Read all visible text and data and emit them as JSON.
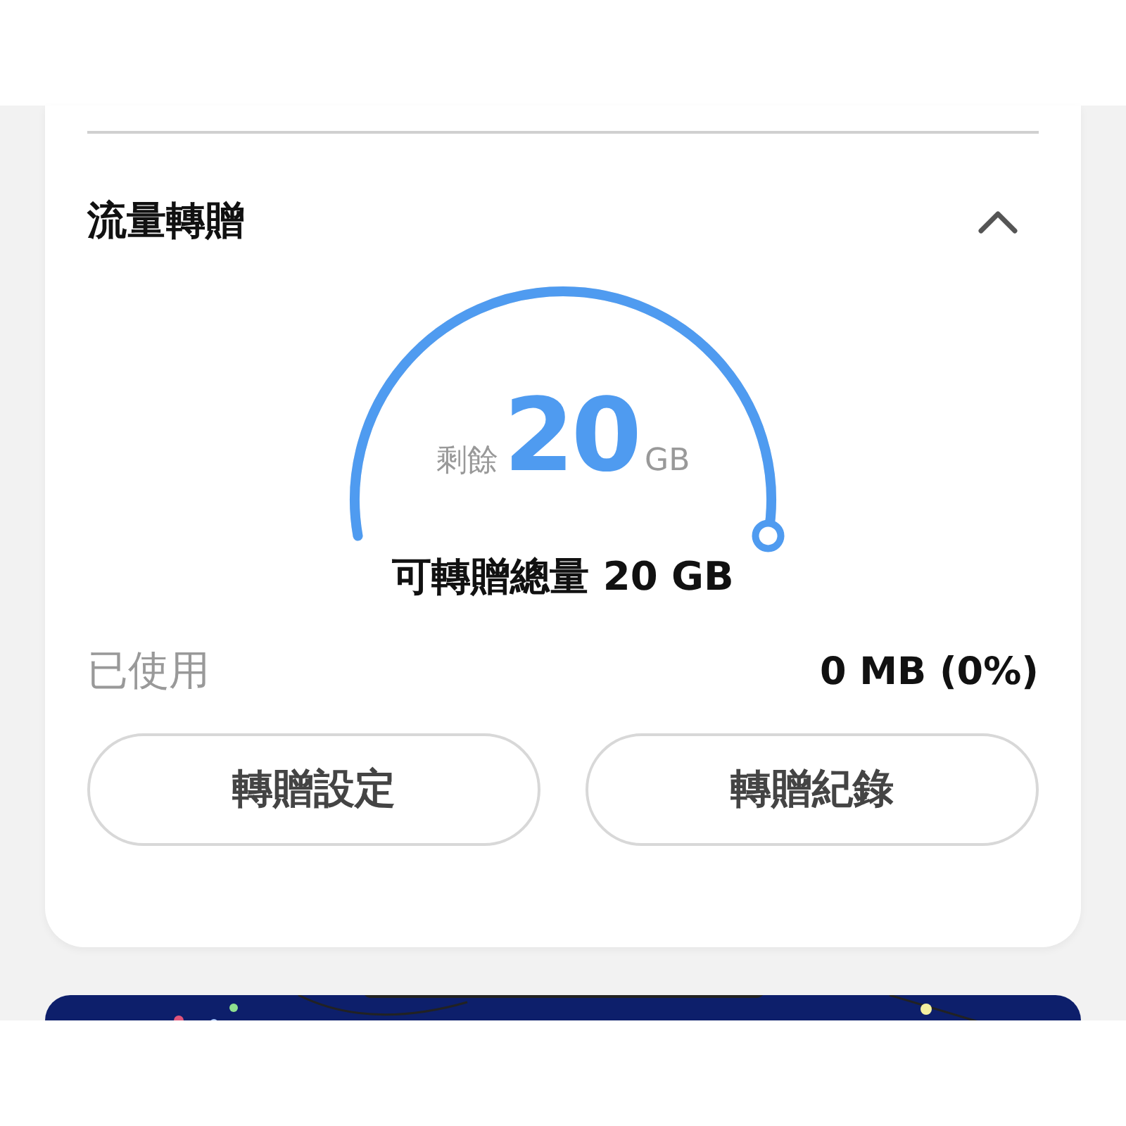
{
  "section": {
    "title": "流量轉贈",
    "expanded": true
  },
  "gauge": {
    "level": 1,
    "prefix": "剩餘",
    "value": "20",
    "unit": "GB"
  },
  "total_label": "可轉贈總量 20 GB",
  "usage": {
    "label": "已使用",
    "value": "0 MB (0%)"
  },
  "buttons": [
    "轉贈設定",
    "轉贈紀錄"
  ]
}
